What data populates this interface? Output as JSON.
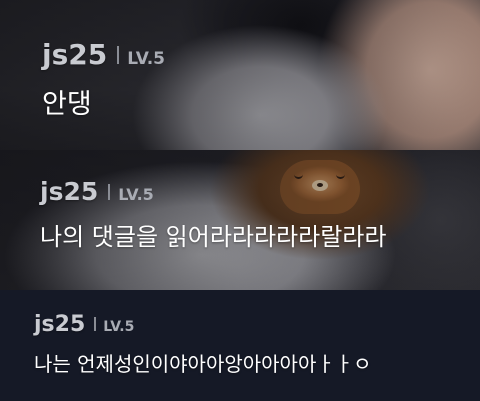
{
  "comments": [
    {
      "username": "js25",
      "level": "LV.5",
      "text": "안댕"
    },
    {
      "username": "js25",
      "level": "LV.5",
      "text": "나의 댓글을 읽어라라라라라랄라라"
    },
    {
      "username": "js25",
      "level": "LV.5",
      "text": "나는 언제성인이야아아앙아아아아ㅏㅏㅇ"
    }
  ],
  "colors": {
    "background": "#151926",
    "username": "#c9cbd1",
    "level": "#a9acb4",
    "text": "#ffffff"
  }
}
